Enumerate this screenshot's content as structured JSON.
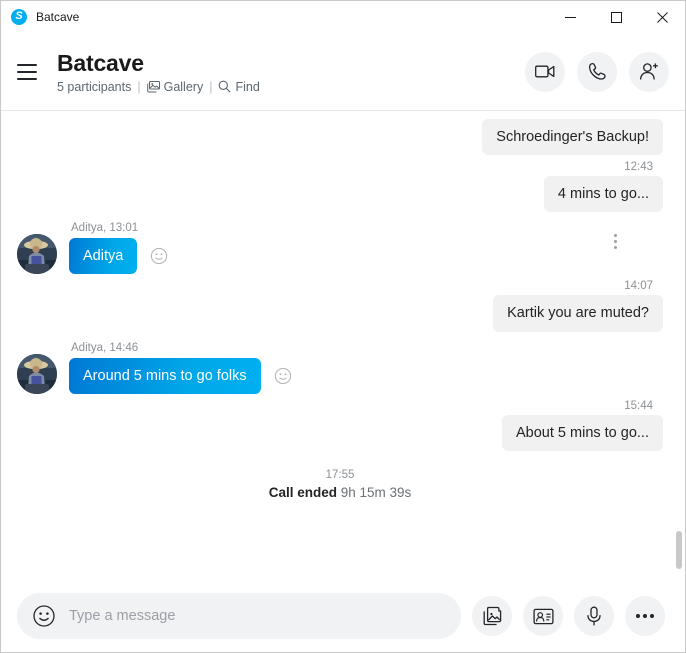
{
  "window": {
    "titlebar_title": "Batcave",
    "app_icon": "skype-logo-icon",
    "logo_letter": "S",
    "controls": {
      "minimize": "—",
      "maximize": "☐",
      "close": "✕"
    }
  },
  "header": {
    "menu_icon": "hamburger-menu-icon",
    "title": "Batcave",
    "participants": "5 participants",
    "separator": "|",
    "gallery_label": "Gallery",
    "find_label": "Find",
    "actions": {
      "video_call": "video-call-icon",
      "audio_call": "audio-call-icon",
      "add_people": "add-people-icon"
    }
  },
  "conversation": {
    "messages": [
      {
        "id": "m1",
        "direction": "out",
        "text": "Schroedinger's Backup!",
        "time": "12:43"
      },
      {
        "id": "m2",
        "direction": "out",
        "text": "4 mins to go...",
        "time": ""
      },
      {
        "id": "m3",
        "direction": "in",
        "sender": "Aditya, 13:01",
        "text": "Aditya",
        "reaction_icon": "emoji-reaction-icon",
        "more_icon": "message-options-icon"
      },
      {
        "id": "m4",
        "direction": "out",
        "text": "Kartik you are muted?",
        "time": "14:07"
      },
      {
        "id": "m5",
        "direction": "in",
        "sender": "Aditya, 14:46",
        "text": "Around 5 mins to go folks",
        "reaction_icon": "emoji-reaction-icon"
      },
      {
        "id": "m6",
        "direction": "out",
        "text": "About 5 mins to go...",
        "time": "15:44"
      }
    ],
    "system_event": {
      "time": "17:55",
      "label": "Call ended",
      "duration": "9h 15m 39s"
    }
  },
  "composer": {
    "emoji_icon": "emoji-picker-icon",
    "placeholder": "Type a message",
    "value": "",
    "buttons": {
      "media": "media-gallery-icon",
      "contact": "contact-card-icon",
      "voice": "microphone-icon",
      "more": "more-options-icon"
    }
  },
  "colors": {
    "accent": "#00aff0",
    "bubble_out": "#f1f1f1",
    "bubble_in_start": "#0078d4",
    "bubble_in_end": "#00b0f0",
    "muted_text": "#8c9196"
  }
}
